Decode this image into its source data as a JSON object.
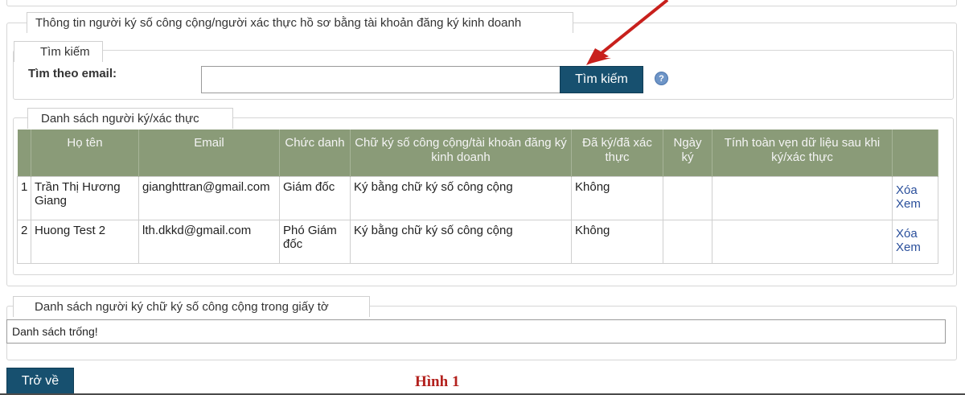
{
  "section_main": {
    "legend": "Thông tin người ký số công cộng/người xác thực hồ sơ bằng tài khoản đăng ký kinh doanh"
  },
  "search": {
    "legend": "Tìm kiếm",
    "email_label": "Tìm theo email:",
    "email_value": "",
    "button_label": "Tìm kiếm",
    "help_icon": "question-circle-icon"
  },
  "signers": {
    "legend": "Danh sách người ký/xác thực",
    "columns": [
      "",
      "Họ tên",
      "Email",
      "Chức danh",
      "Chữ ký số công cộng/tài khoản đăng ký kinh doanh",
      "Đã ký/đã xác thực",
      "Ngày ký",
      "Tính toàn vẹn dữ liệu sau khi ký/xác thực",
      ""
    ],
    "rows": [
      {
        "no": "1",
        "name": "Trần Thị Hương Giang",
        "email": "gianghttran@gmail.com",
        "title": "Giám đốc",
        "method": "Ký bằng chữ ký số công cộng",
        "signed": "Không",
        "date": "",
        "integrity": "",
        "delete": "Xóa",
        "view": "Xem"
      },
      {
        "no": "2",
        "name": "Huong Test 2",
        "email": "lth.dkkd@gmail.com",
        "title": "Phó Giám đốc",
        "method": "Ký bằng chữ ký số công cộng",
        "signed": "Không",
        "date": "",
        "integrity": "",
        "delete": "Xóa",
        "view": "Xem"
      }
    ]
  },
  "doc_signers": {
    "legend": "Danh sách người ký chữ ký số công cộng trong giấy tờ",
    "empty_text": "Danh sách trống!"
  },
  "footer": {
    "back_label": "Trở về",
    "caption": "Hình 1"
  },
  "colors": {
    "header_bg": "#8a9b78",
    "button_bg": "#17506f",
    "link": "#2a4f9b",
    "caption": "#b3211d",
    "arrow": "#c8201c"
  }
}
